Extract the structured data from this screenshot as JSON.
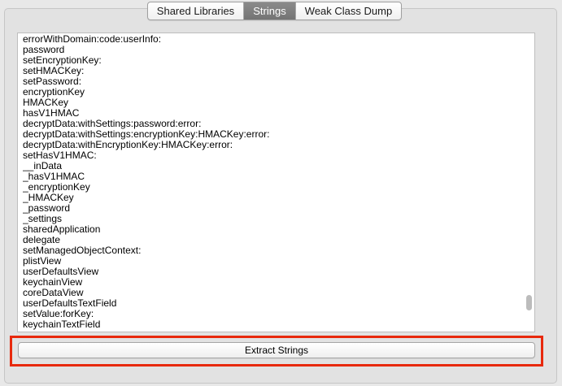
{
  "tabs": [
    {
      "label": "Shared Libraries",
      "selected": false
    },
    {
      "label": "Strings",
      "selected": true
    },
    {
      "label": "Weak Class Dump",
      "selected": false
    }
  ],
  "strings_list": [
    "errorWithDomain:code:userInfo:",
    "password",
    "setEncryptionKey:",
    "setHMACKey:",
    "setPassword:",
    "encryptionKey",
    "HMACKey",
    "hasV1HMAC",
    "decryptData:withSettings:password:error:",
    "decryptData:withSettings:encryptionKey:HMACKey:error:",
    "decryptData:withEncryptionKey:HMACKey:error:",
    "setHasV1HMAC:",
    "__inData",
    "_hasV1HMAC",
    "_encryptionKey",
    "_HMACKey",
    "_password",
    "_settings",
    "sharedApplication",
    "delegate",
    "setManagedObjectContext:",
    "plistView",
    "userDefaultsView",
    "keychainView",
    "coreDataView",
    "userDefaultsTextField",
    "setValue:forKey:",
    "keychainTextField"
  ],
  "extract_button": {
    "label": "Extract Strings"
  },
  "colors": {
    "highlight_border": "#e8290c",
    "selected_tab": "#7f7f7f",
    "panel_background": "#e2e2e2"
  }
}
